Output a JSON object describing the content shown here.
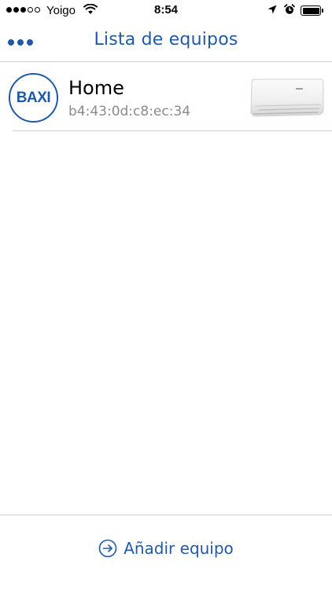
{
  "status_bar": {
    "signal_bars_filled": 3,
    "signal_bars_total": 5,
    "carrier": "Yoigo",
    "time": "8:54",
    "icons": [
      "wifi-icon",
      "location-arrow-icon",
      "alarm-clock-icon",
      "battery-icon"
    ]
  },
  "nav": {
    "menu_icon": "more-dots-icon",
    "title": "Lista de equipos"
  },
  "devices": [
    {
      "brand": "BAXI",
      "name": "Home",
      "mac": "b4:43:0d:c8:ec:34",
      "image": "air-conditioner-unit"
    }
  ],
  "bottom_bar": {
    "add_icon": "arrow-right-circle-icon",
    "add_label": "Añadir equipo"
  },
  "colors": {
    "accent": "#1f5aa6",
    "divider": "#cfcfcf",
    "secondary_text": "#8a8a8a"
  }
}
